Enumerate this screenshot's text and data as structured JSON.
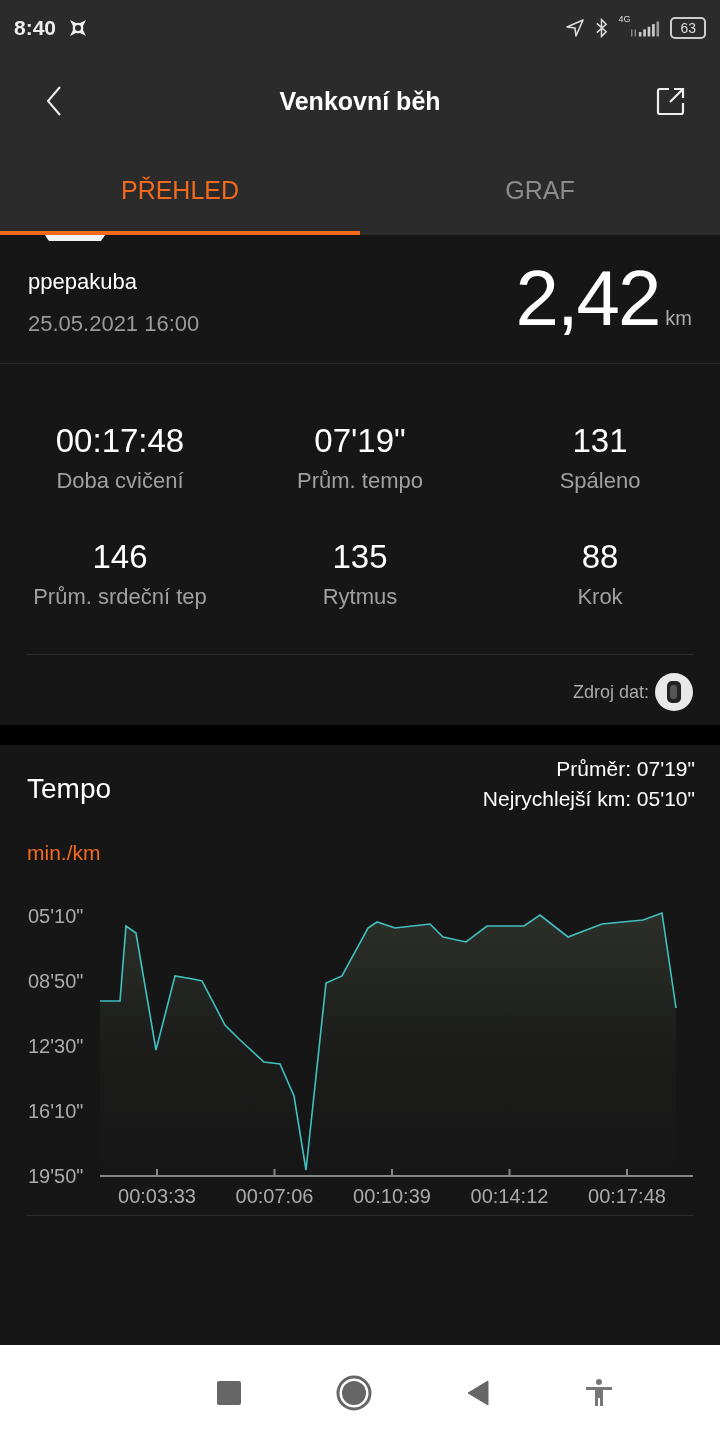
{
  "status_bar": {
    "time": "8:40",
    "network": "4G",
    "battery": "63"
  },
  "header": {
    "title": "Venkovní běh"
  },
  "tabs": [
    {
      "label": "PŘEHLED",
      "selected": true
    },
    {
      "label": "GRAF",
      "selected": false
    }
  ],
  "summary": {
    "user": "ppepakuba",
    "datetime": "25.05.2021 16:00",
    "distance": "2,42",
    "unit": "km"
  },
  "stats": [
    {
      "value": "00:17:48",
      "label": "Doba cvičení"
    },
    {
      "value": "07'19\"",
      "label": "Prům. tempo"
    },
    {
      "value": "131",
      "label": "Spáleno"
    },
    {
      "value": "146",
      "label": "Prům. srdeční tep"
    },
    {
      "value": "135",
      "label": "Rytmus"
    },
    {
      "value": "88",
      "label": "Krok"
    }
  ],
  "source": {
    "label": "Zdroj dat:"
  },
  "tempo": {
    "title": "Tempo",
    "average": "Průměr: 07'19\"",
    "fastest": "Nejrychlejší km: 05'10\"",
    "unit": "min./km",
    "y_axis_labels": [
      "05'10\"",
      "08'50\"",
      "12'30\"",
      "16'10\"",
      "19'50\""
    ],
    "x_axis_labels": [
      "00:03:33",
      "00:07:06",
      "00:10:39",
      "00:14:12",
      "00:17:48"
    ]
  }
}
